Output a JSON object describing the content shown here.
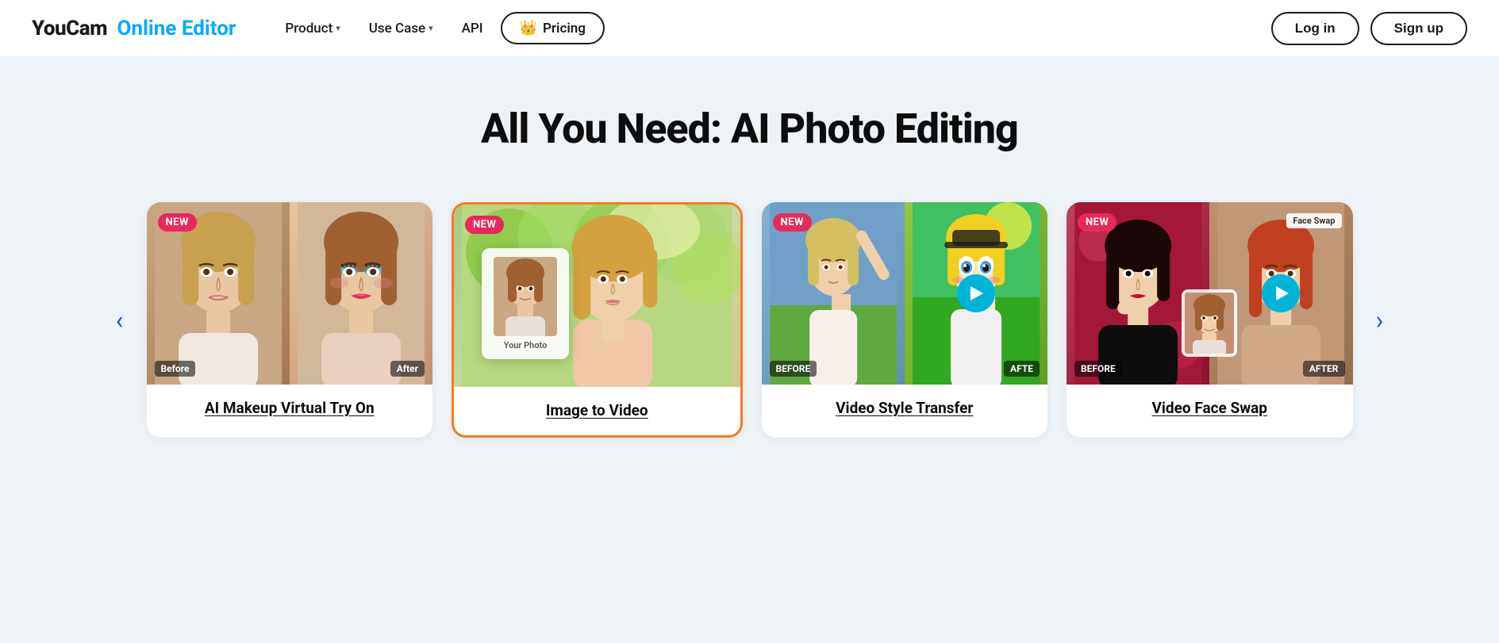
{
  "brand": {
    "youcam": "YouCam",
    "online_editor": "Online Editor"
  },
  "nav": {
    "product_label": "Product",
    "usecase_label": "Use Case",
    "api_label": "API",
    "pricing_label": "Pricing",
    "login_label": "Log in",
    "signup_label": "Sign up"
  },
  "main": {
    "section_title": "All You Need: AI Photo Editing"
  },
  "carousel": {
    "prev_arrow": "‹",
    "next_arrow": "›",
    "cards": [
      {
        "id": "card-makeup",
        "badge": "NEW",
        "label": "AI Makeup Virtual Try On",
        "before": "Before",
        "after": "After",
        "active": false
      },
      {
        "id": "card-image-to-video",
        "badge": "NEW",
        "label": "Image to Video",
        "your_photo": "Your Photo",
        "active": true
      },
      {
        "id": "card-style-transfer",
        "badge": "NEW",
        "label": "Video Style Transfer",
        "before": "BEFORE",
        "after": "AFTE",
        "active": false
      },
      {
        "id": "card-face-swap",
        "badge": "NEW",
        "label": "Video Face Swap",
        "face_swap_label": "Face Swap",
        "before": "BEFORE",
        "after": "AFTER",
        "active": false
      }
    ]
  },
  "colors": {
    "accent_blue": "#00aaff",
    "accent_orange": "#f47c20",
    "badge_pink": "#e8295a",
    "nav_border": "#1a1a1a",
    "play_teal": "#00b4d8"
  }
}
